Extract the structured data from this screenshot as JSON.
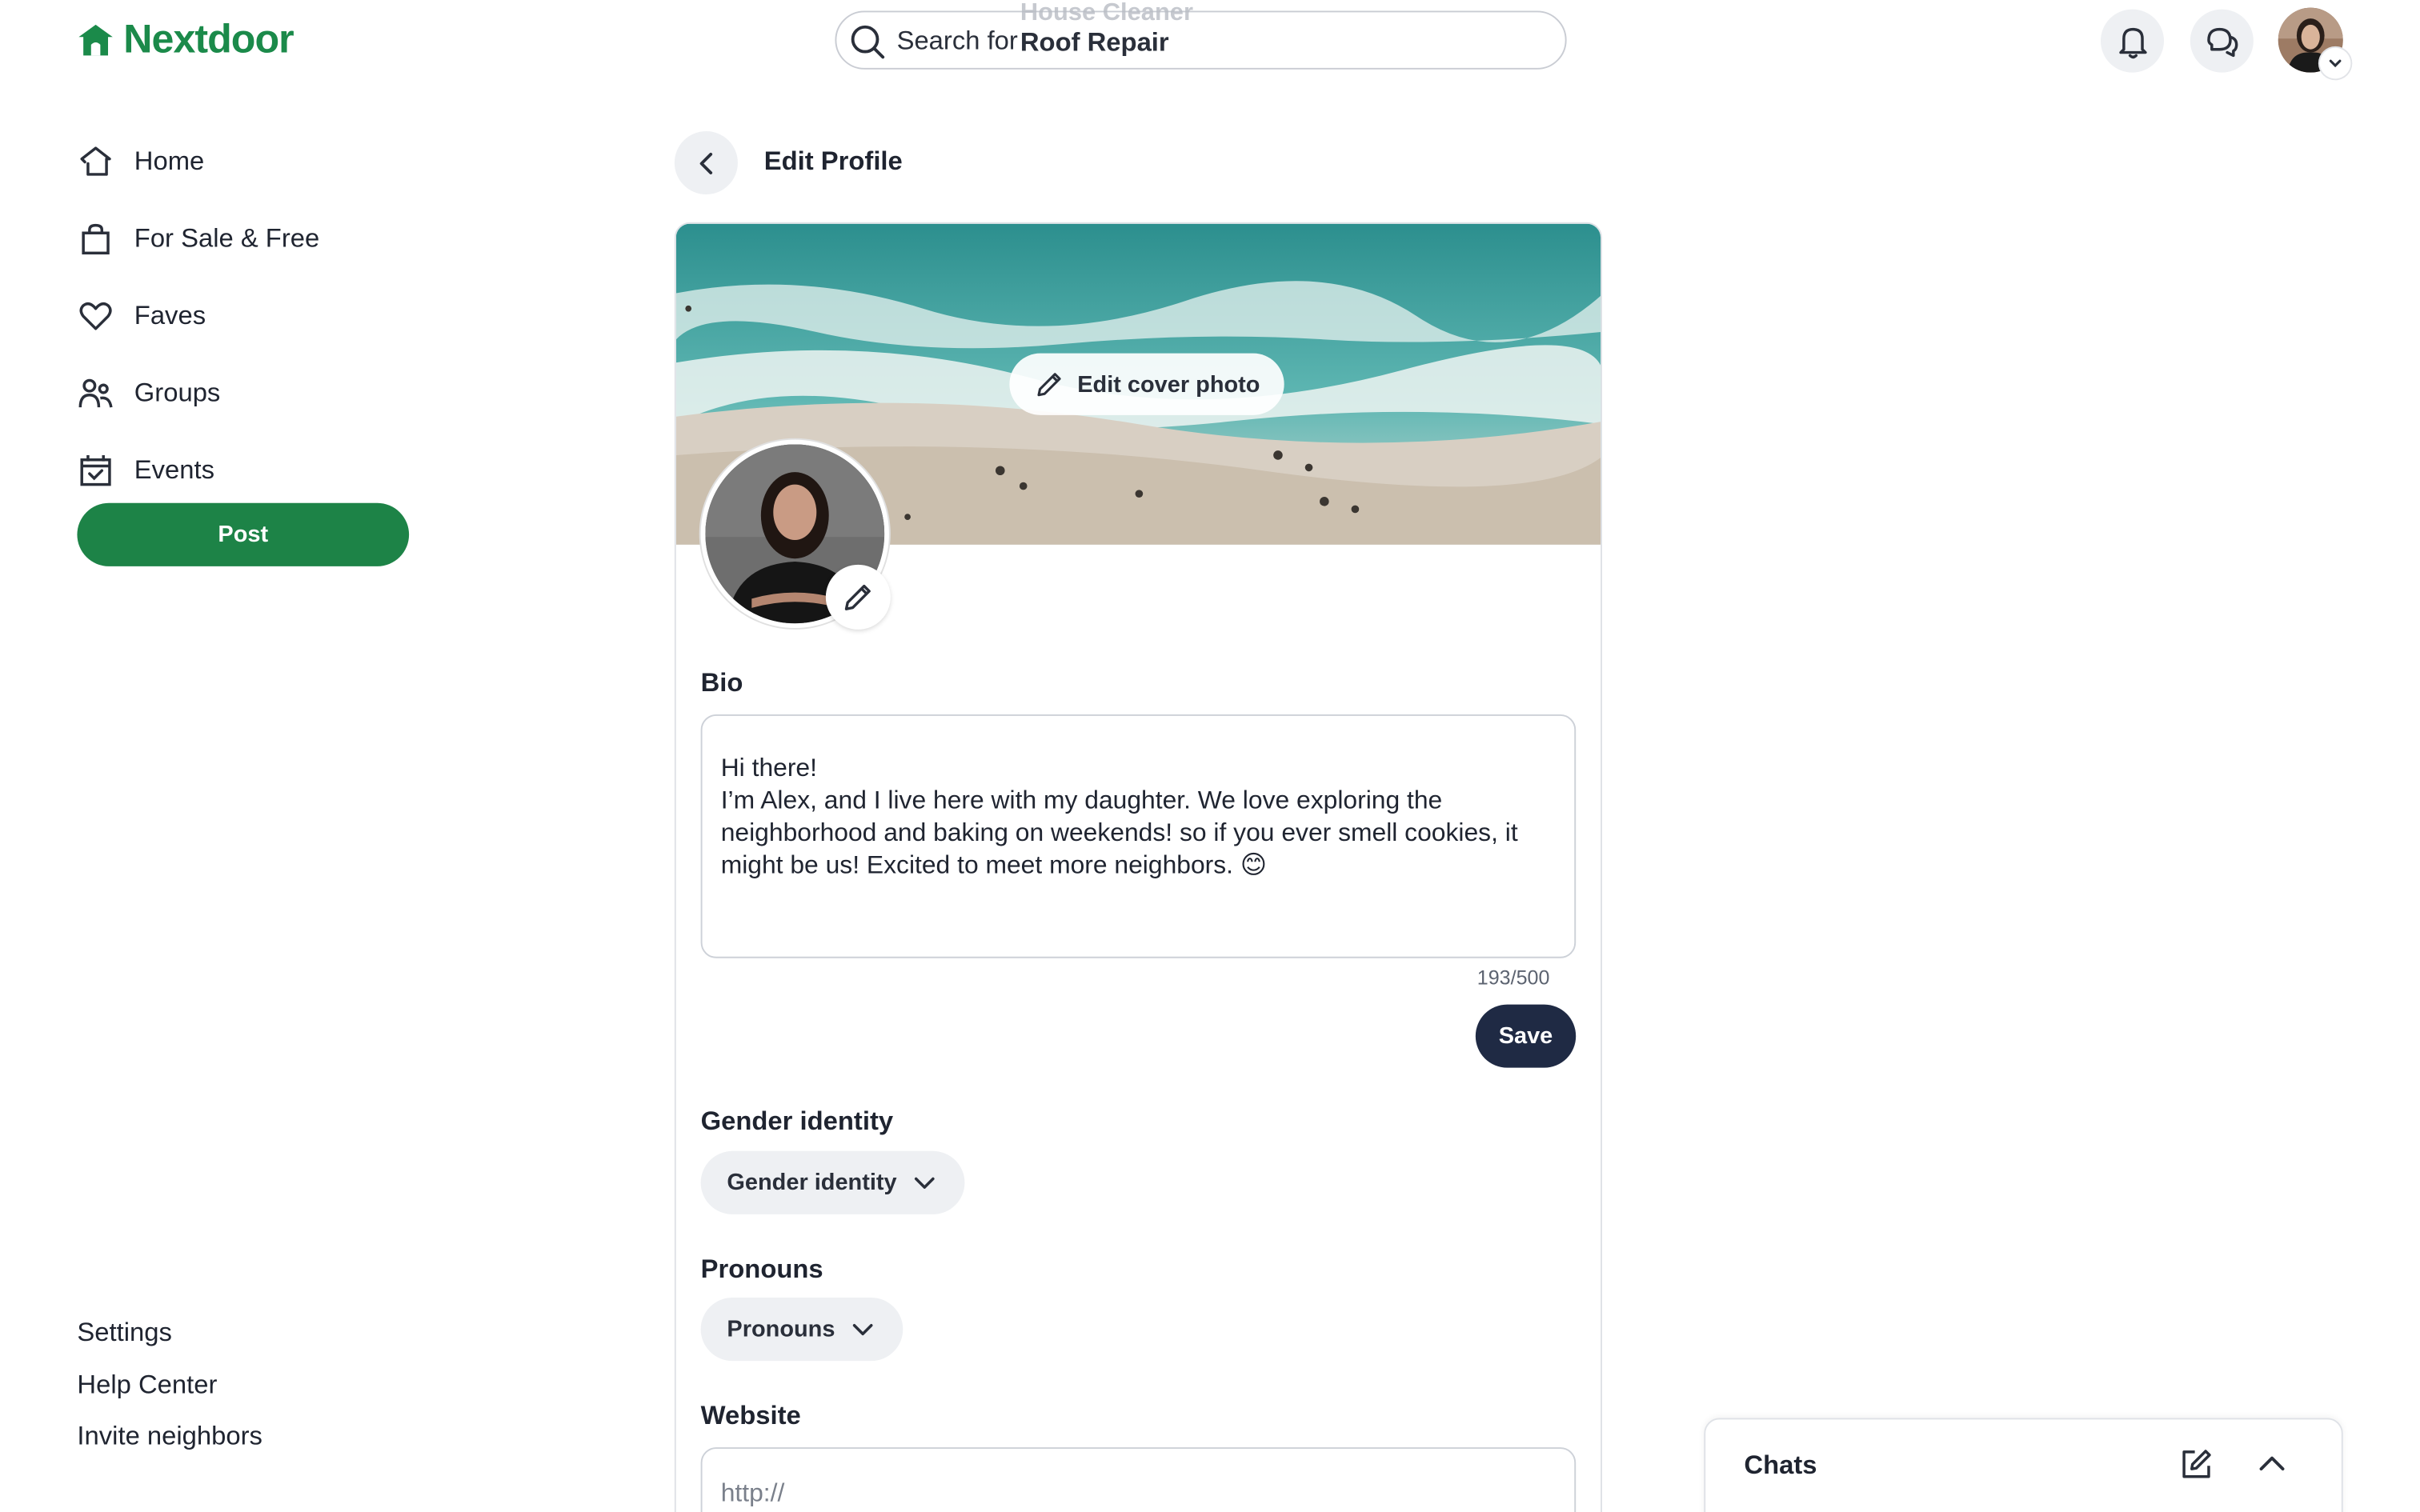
{
  "app": {
    "name": "Nextdoor",
    "brand_color": "#1d8347"
  },
  "search": {
    "prefix": "Search for",
    "term": "Roof Repair",
    "ghost_term": "House Cleaner"
  },
  "header": {
    "icons": [
      "bell-icon",
      "chat-bubbles-icon",
      "avatar-menu"
    ]
  },
  "sidebar": {
    "items": [
      {
        "label": "Home",
        "icon": "home-icon"
      },
      {
        "label": "For Sale & Free",
        "icon": "shopping-bag-icon"
      },
      {
        "label": "Faves",
        "icon": "heart-icon"
      },
      {
        "label": "Groups",
        "icon": "groups-icon"
      },
      {
        "label": "Events",
        "icon": "calendar-icon"
      }
    ],
    "post_label": "Post",
    "footer": [
      "Settings",
      "Help Center",
      "Invite neighbors"
    ]
  },
  "page": {
    "title": "Edit Profile"
  },
  "cover": {
    "edit_label": "Edit cover photo"
  },
  "bio": {
    "label": "Bio",
    "value": "Hi there!\nI’m Alex, and I live here with my daughter. We love exploring the neighborhood and baking on weekends! so if you ever smell cookies, it might be us! Excited to meet more neighbors. 😊",
    "counter": "193/500",
    "save_label": "Save"
  },
  "gender": {
    "label": "Gender identity",
    "dropdown": "Gender identity"
  },
  "pronouns": {
    "label": "Pronouns",
    "dropdown": "Pronouns"
  },
  "website": {
    "label": "Website",
    "placeholder": "http://"
  },
  "chats": {
    "title": "Chats"
  }
}
